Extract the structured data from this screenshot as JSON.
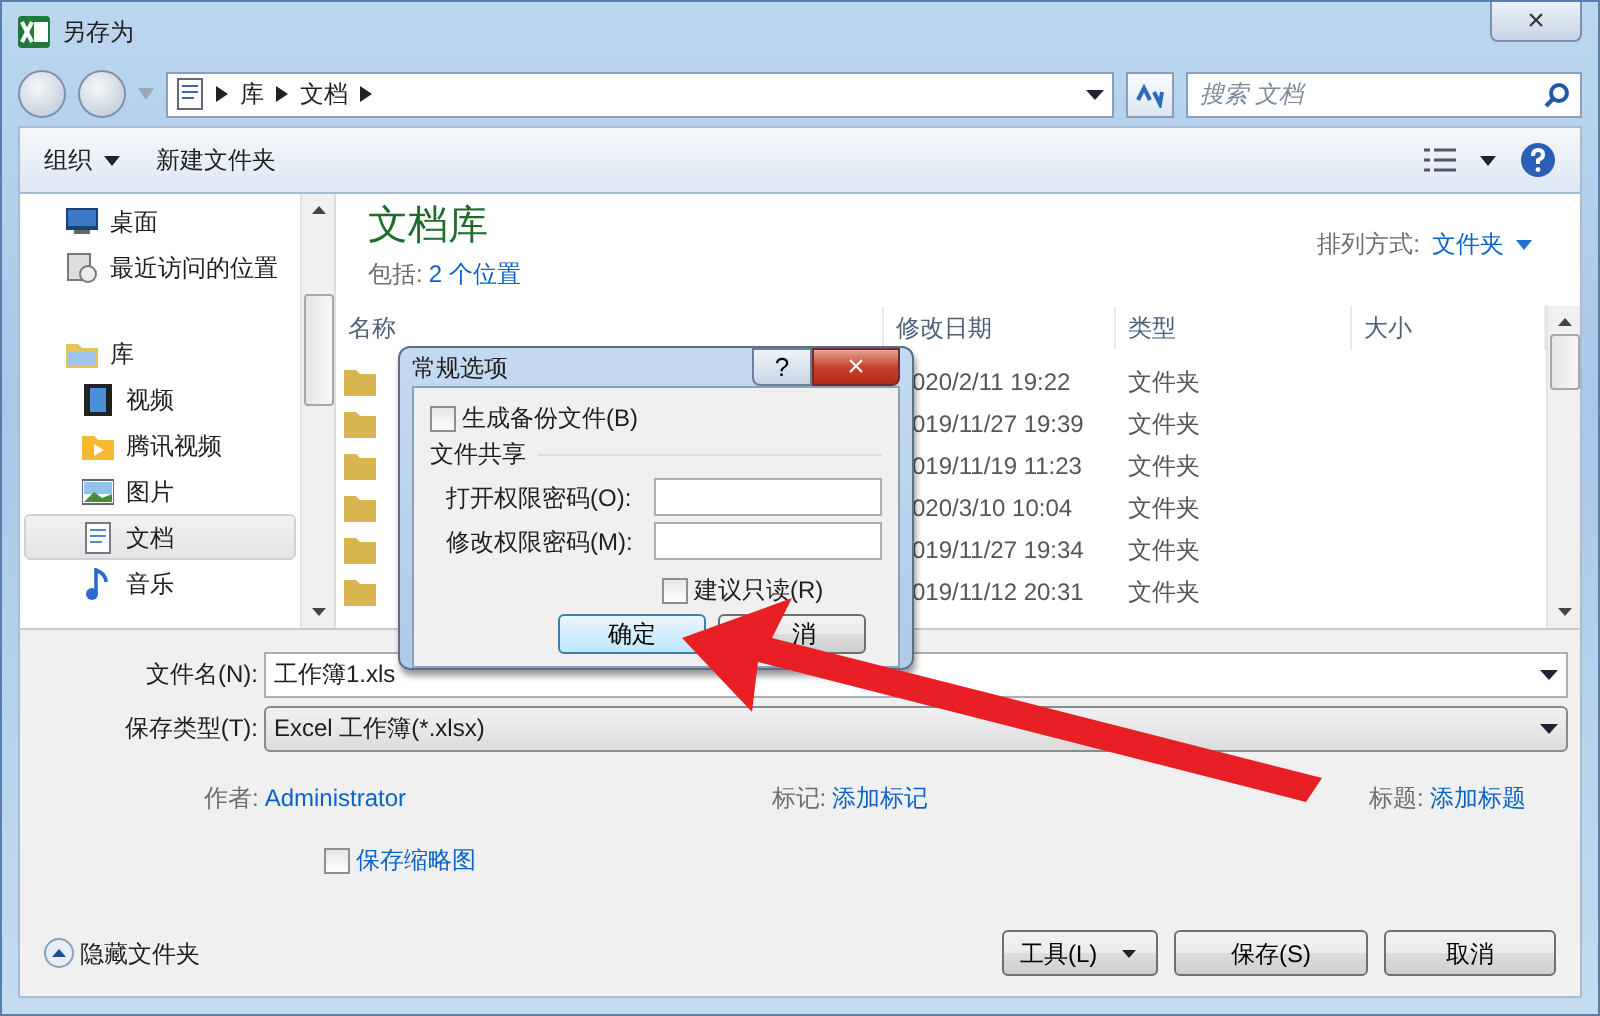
{
  "window": {
    "title": "另存为",
    "close": "×"
  },
  "nav": {
    "breadcrumbs": [
      "库",
      "文档"
    ],
    "search_placeholder": "搜索 文档"
  },
  "toolbar": {
    "organize": "组织",
    "new_folder": "新建文件夹"
  },
  "sidebar": {
    "items": [
      {
        "label": "桌面",
        "kind": "desktop",
        "selected": false
      },
      {
        "label": "最近访问的位置",
        "kind": "recent",
        "selected": false
      },
      {
        "label": "库",
        "kind": "library",
        "selected": false,
        "children": [
          {
            "label": "视频",
            "kind": "video",
            "selected": false
          },
          {
            "label": "腾讯视频",
            "kind": "tencent",
            "selected": false
          },
          {
            "label": "图片",
            "kind": "pictures",
            "selected": false
          },
          {
            "label": "文档",
            "kind": "documents",
            "selected": true
          },
          {
            "label": "音乐",
            "kind": "music",
            "selected": false
          }
        ]
      }
    ]
  },
  "library": {
    "title": "文档库",
    "includes_label": "包括:",
    "includes_link": "2 个位置",
    "sort_label": "排列方式:",
    "sort_value": "文件夹"
  },
  "table": {
    "columns": [
      "名称",
      "修改日期",
      "类型",
      "大小"
    ],
    "rows": [
      {
        "date": "020/2/11 19:22",
        "type": "文件夹"
      },
      {
        "date": "019/11/27 19:39",
        "type": "文件夹"
      },
      {
        "date": "019/11/19 11:23",
        "type": "文件夹"
      },
      {
        "date": "020/3/10 10:04",
        "type": "文件夹"
      },
      {
        "date": "019/11/27 19:34",
        "type": "文件夹"
      },
      {
        "date": "019/11/12 20:31",
        "type": "文件夹"
      }
    ]
  },
  "form": {
    "file_name_label": "文件名(N):",
    "file_name": "工作簿1.xls",
    "type_label": "保存类型(T):",
    "type_value": "Excel 工作簿(*.xlsx)"
  },
  "meta": [
    {
      "label": "作者:",
      "value": "Administrator"
    },
    {
      "label": "标记:",
      "value": "添加标记"
    },
    {
      "label": "标题:",
      "value": "添加标题"
    }
  ],
  "thumbnail": {
    "label": "保存缩略图",
    "checked": false
  },
  "hide_folders": "隐藏文件夹",
  "buttons": {
    "tools": "工具(L)",
    "save": "保存(S)",
    "cancel": "取消"
  },
  "options_dialog": {
    "title": "常规选项",
    "help": "?",
    "close": "×",
    "backup": {
      "label": "生成备份文件(B)",
      "checked": false
    },
    "section": "文件共享",
    "open_password_label": "打开权限密码(O):",
    "modify_password_label": "修改权限密码(M):",
    "read_only": {
      "label": "建议只读(R)",
      "checked": false
    },
    "ok": "确定",
    "cancel": "消"
  }
}
